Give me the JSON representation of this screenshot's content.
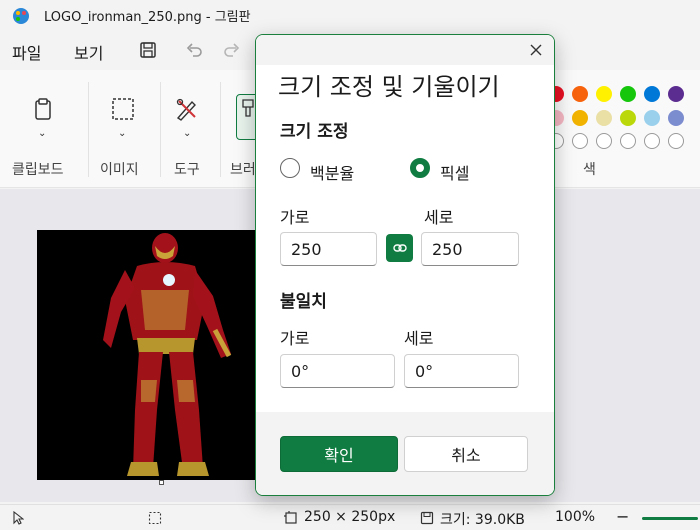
{
  "window": {
    "title": "LOGO_ironman_250.png - 그림판"
  },
  "menu": {
    "file": "파일",
    "view": "보기"
  },
  "ribbon": {
    "clipboard": "클립보드",
    "image": "이미지",
    "tools": "도구",
    "brush_partial": "브러",
    "colors": "색",
    "swatches_row1": [
      "#e81123",
      "#f7630c",
      "#fff100",
      "#16c60c",
      "#0078d7",
      "#5c2d91"
    ],
    "swatches_row2": [
      "#f4b6c2",
      "#f7c99b",
      "#fffbb0",
      "#bad80a",
      "#9ad0ec",
      "#b4a7d6"
    ]
  },
  "dialog": {
    "title": "크기 조정 및 기울이기",
    "resize_section": "크기 조정",
    "option_percent": "백분율",
    "option_pixel": "픽셀",
    "width_label": "가로",
    "height_label": "세로",
    "width_value": "250",
    "height_value": "250",
    "skew_section": "불일치",
    "skew_h_label": "가로",
    "skew_v_label": "세로",
    "skew_h_value": "0°",
    "skew_v_value": "0°",
    "ok": "확인",
    "cancel": "취소"
  },
  "status": {
    "dimensions": "250 × 250px",
    "size": "크기: 39.0KB",
    "zoom": "100%"
  },
  "colors": {
    "accent": "#107c41"
  }
}
